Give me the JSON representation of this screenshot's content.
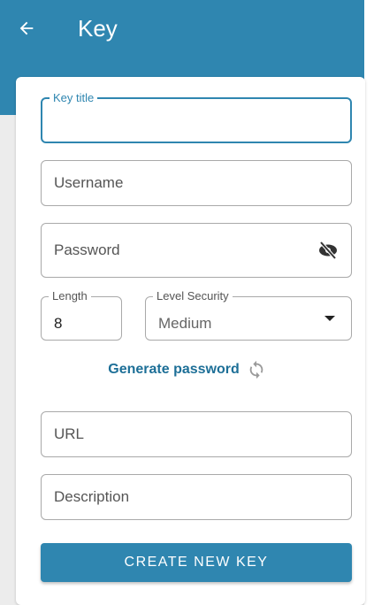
{
  "header": {
    "title": "Key",
    "back_icon": "arrow-left-icon"
  },
  "form": {
    "key_title": {
      "label": "Key title",
      "value": ""
    },
    "username": {
      "placeholder": "Username"
    },
    "password": {
      "placeholder": "Password",
      "visibility_icon": "eye-off-icon"
    },
    "length": {
      "label": "Length",
      "value": "8"
    },
    "level_security": {
      "label": "Level Security",
      "selected": "Medium"
    },
    "generate_password": {
      "label": "Generate password",
      "icon": "refresh-icon"
    },
    "url": {
      "placeholder": "URL"
    },
    "description": {
      "placeholder": "Description"
    },
    "submit_label": "CREATE NEW KEY"
  },
  "colors": {
    "primary": "#2f86b0",
    "link": "#1d6f97",
    "border": "#a9a9a9"
  }
}
